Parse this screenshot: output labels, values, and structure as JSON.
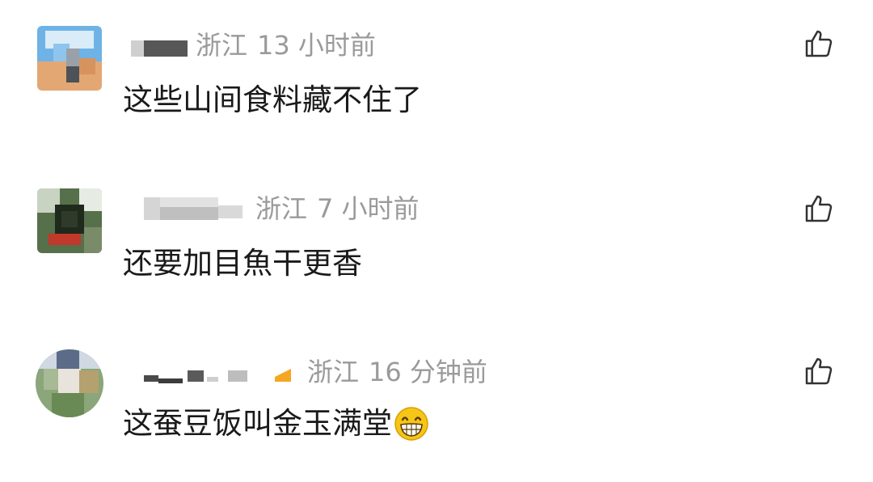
{
  "comments": [
    {
      "location": "浙江",
      "time": "13 小时前",
      "text": "这些山间食料藏不住了"
    },
    {
      "location": "浙江",
      "time": "7 小时前",
      "text": "还要加目魚干更香"
    },
    {
      "location": "浙江",
      "time": "16 分钟前",
      "text": "这蚕豆饭叫金玉满堂",
      "emoji": "grinning-face-emoji"
    }
  ],
  "icons": {
    "like": "thumbs-up-icon"
  },
  "colors": {
    "meta_text": "#9a9a9a",
    "body_text": "#1a1a1a",
    "icon_stroke": "#333333",
    "emoji_fill": "#f5c518"
  }
}
